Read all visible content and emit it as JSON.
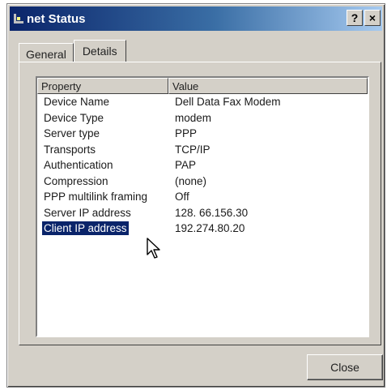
{
  "window": {
    "title": "net Status",
    "help_label": "?",
    "close_label": "×"
  },
  "tabs": [
    {
      "label": "General"
    },
    {
      "label": "Details"
    }
  ],
  "list": {
    "columns": [
      "Property",
      "Value"
    ],
    "rows": [
      {
        "property": "Device Name",
        "value": "Dell Data Fax Modem"
      },
      {
        "property": "Device Type",
        "value": "modem"
      },
      {
        "property": "Server type",
        "value": "PPP"
      },
      {
        "property": "Transports",
        "value": "TCP/IP"
      },
      {
        "property": "Authentication",
        "value": "PAP"
      },
      {
        "property": "Compression",
        "value": "(none)"
      },
      {
        "property": "PPP multilink framing",
        "value": "Off"
      },
      {
        "property": "Server IP address",
        "value": "128. 66.156.30"
      },
      {
        "property": "Client IP address",
        "value": "192.274.80.20"
      }
    ],
    "selected_index": 8
  },
  "buttons": {
    "close": "Close"
  }
}
